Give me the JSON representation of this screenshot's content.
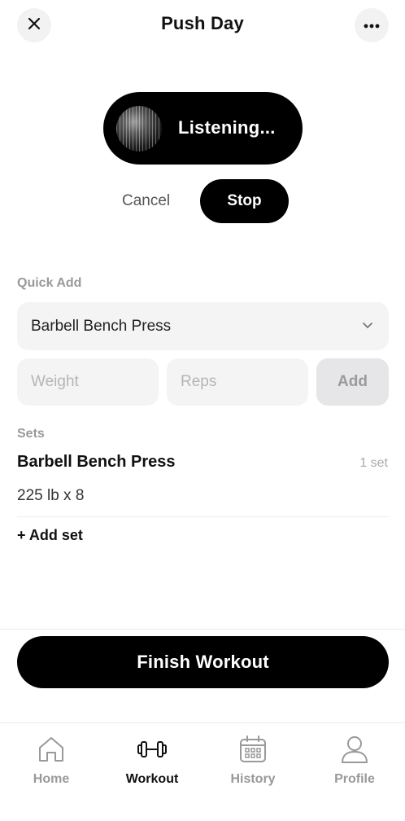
{
  "header": {
    "title": "Push Day",
    "close_icon": "close-icon",
    "more_icon": "more-horizontal-icon"
  },
  "voice": {
    "status": "Listening...",
    "cancel_label": "Cancel",
    "stop_label": "Stop"
  },
  "quick_add": {
    "label": "Quick Add",
    "exercise_selected": "Barbell Bench Press",
    "weight_placeholder": "Weight",
    "reps_placeholder": "Reps",
    "add_label": "Add"
  },
  "sets": {
    "label": "Sets",
    "exercises": [
      {
        "name": "Barbell Bench Press",
        "count": "1 set",
        "entries": [
          "225 lb x 8"
        ],
        "add_set_label": "+ Add set"
      }
    ]
  },
  "finish_label": "Finish Workout",
  "tabs": [
    {
      "label": "Home",
      "icon": "home-icon",
      "active": false
    },
    {
      "label": "Workout",
      "icon": "dumbbell-icon",
      "active": true
    },
    {
      "label": "History",
      "icon": "calendar-icon",
      "active": false
    },
    {
      "label": "Profile",
      "icon": "user-icon",
      "active": false
    }
  ],
  "colors": {
    "primary": "#000000",
    "surface": "#f4f4f4",
    "muted_text": "#999999",
    "disabled_button": "#e6e6e8"
  }
}
